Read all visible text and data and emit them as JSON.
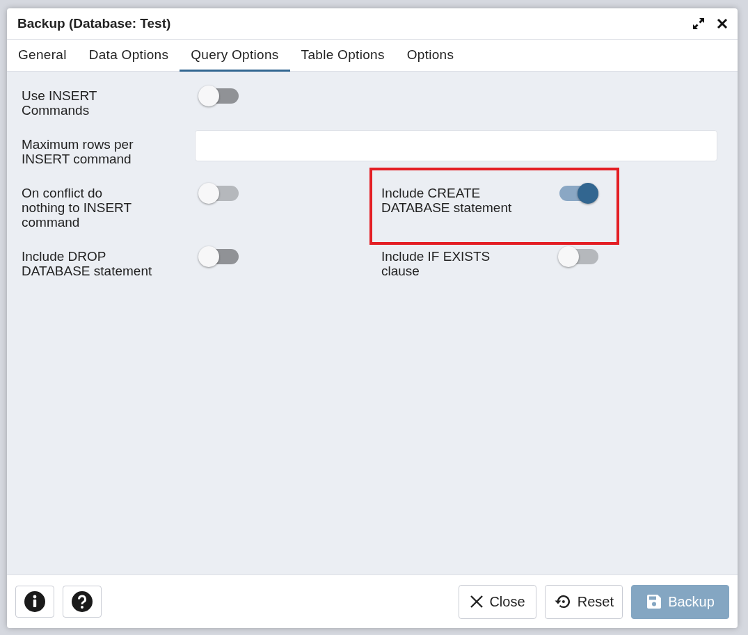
{
  "window": {
    "title": "Backup (Database: Test)"
  },
  "tabs": [
    {
      "label": "General",
      "selected": false
    },
    {
      "label": "Data Options",
      "selected": false
    },
    {
      "label": "Query Options",
      "selected": true
    },
    {
      "label": "Table Options",
      "selected": false
    },
    {
      "label": "Options",
      "selected": false
    }
  ],
  "rows": [
    {
      "items": [
        {
          "kind": "toggle",
          "label": "Use INSERT\nCommands",
          "on": false,
          "disabled": false,
          "highlighted": false
        }
      ]
    },
    {
      "items": [
        {
          "kind": "input",
          "label": "Maximum rows per\nINSERT command",
          "highlighted": false
        }
      ]
    },
    {
      "items": [
        {
          "kind": "toggle",
          "label": "On conflict do\nnothing to INSERT\ncommand",
          "on": false,
          "disabled": true,
          "highlighted": false
        },
        {
          "kind": "toggle",
          "label": "Include CREATE\nDATABASE statement",
          "on": true,
          "disabled": false,
          "highlighted": true
        }
      ]
    },
    {
      "items": [
        {
          "kind": "toggle",
          "label": "Include DROP\nDATABASE statement",
          "on": false,
          "disabled": false,
          "highlighted": false
        },
        {
          "kind": "toggle",
          "label": "Include IF EXISTS\nclause",
          "on": false,
          "disabled": true,
          "highlighted": false
        }
      ]
    }
  ],
  "footer": {
    "left_buttons": [
      {
        "kind": "info"
      },
      {
        "kind": "help"
      }
    ],
    "right_buttons": [
      {
        "kind": "close",
        "label": "Close",
        "disabled": false
      },
      {
        "kind": "reset",
        "label": "Reset",
        "disabled": false
      },
      {
        "kind": "backup",
        "label": "Backup",
        "disabled": true
      }
    ]
  }
}
